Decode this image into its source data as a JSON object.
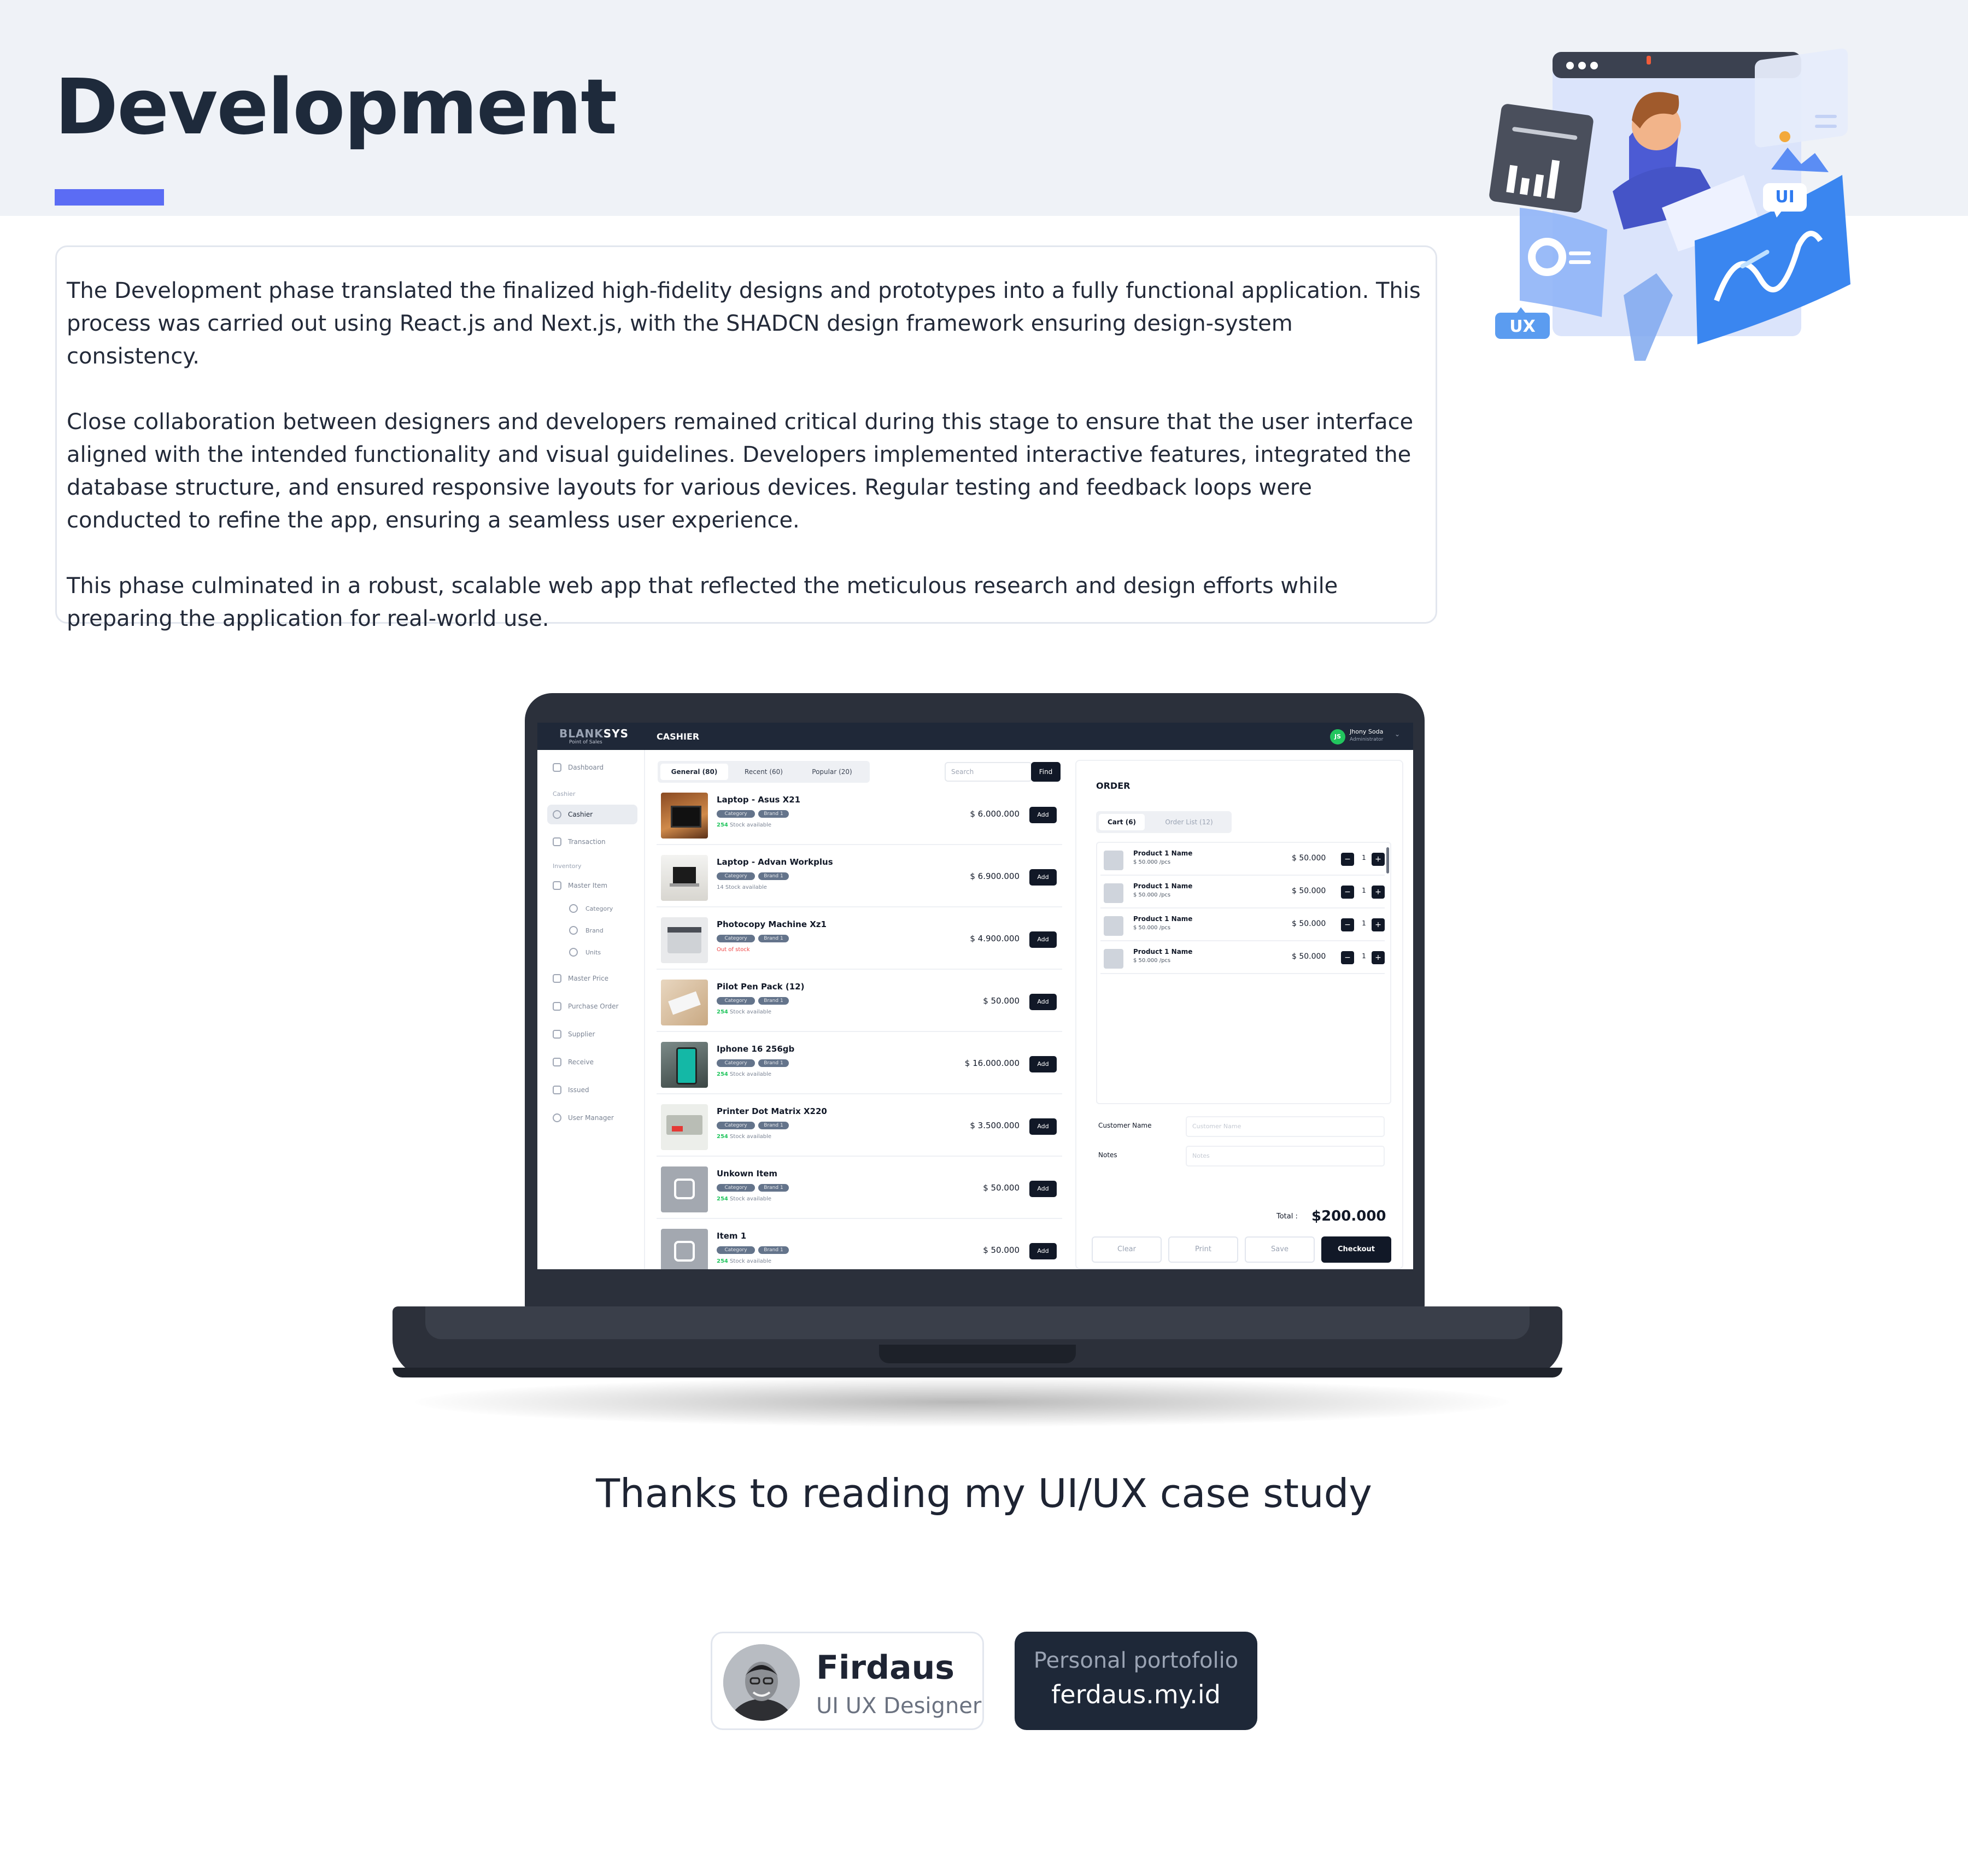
{
  "page": {
    "title": "Development",
    "paragraphs": [
      "The Development phase translated the finalized high-fidelity designs and prototypes into a fully functional application. This process was carried out using React.js and Next.js, with the SHADCN design framework ensuring design-system consistency.",
      "Close collaboration between designers and developers remained critical during this stage to ensure that the user interface aligned with the intended functionality and visual guidelines. Developers implemented interactive features, integrated the database structure, and ensured responsive layouts for various devices. Regular testing and feedback loops were conducted to refine the app, ensuring a seamless user experience.",
      "This phase culminated in a robust, scalable web app that reflected the meticulous research and design efforts while preparing the application for real-world use."
    ],
    "thanks": "Thanks to reading my UI/UX case study",
    "accent_color": "#5b6cf4"
  },
  "hero": {
    "ui_label": "UI",
    "ux_label": "UX"
  },
  "app": {
    "logo_blank": "BLANK",
    "logo_sys": "SYS",
    "logo_sub": "Point of Sales",
    "title": "CASHIER",
    "user": {
      "initials": "JS",
      "name": "Jhony Soda",
      "role": "Administrator"
    },
    "sidebar": {
      "dashboard": "Dashboard",
      "section_cashier": "Cashier",
      "cashier": "Cashier",
      "transaction": "Transaction",
      "section_inventory": "Inventory",
      "master_item": "Master Item",
      "category": "Category",
      "brand": "Brand",
      "units": "Units",
      "master_price": "Master Price",
      "purchase_order": "Purchase Order",
      "supplier": "Supplier",
      "receive": "Receive",
      "issued": "Issued",
      "user_manager": "User Manager"
    },
    "tabs": [
      "General (80)",
      "Recent (60)",
      "Popular (20)"
    ],
    "search_placeholder": "Search",
    "find_label": "Find",
    "pill_category": "Category",
    "pill_brand": "Brand 1",
    "add_label": "Add",
    "products": [
      {
        "name": "Laptop - Asus X21",
        "stock_count": "254",
        "stock_text": " Stock available",
        "price": "$ 6.000.000"
      },
      {
        "name": "Laptop - Advan Workplus",
        "stock_count": "",
        "stock_text": "14 Stock available",
        "price": "$ 6.900.000"
      },
      {
        "name": "Photocopy Machine Xz1",
        "stock_count": "",
        "stock_text": "Out of stock",
        "price": "$ 4.900.000"
      },
      {
        "name": "Pilot Pen Pack (12)",
        "stock_count": "254",
        "stock_text": " Stock available",
        "price": "$ 50.000"
      },
      {
        "name": "Iphone 16 256gb",
        "stock_count": "254",
        "stock_text": " Stock available",
        "price": "$ 16.000.000"
      },
      {
        "name": "Printer Dot Matrix X220",
        "stock_count": "254",
        "stock_text": " Stock available",
        "price": "$ 3.500.000"
      },
      {
        "name": "Unkown Item",
        "stock_count": "254",
        "stock_text": " Stock available",
        "price": "$ 50.000"
      },
      {
        "name": "Item 1",
        "stock_count": "254",
        "stock_text": " Stock available",
        "price": "$ 50.000"
      }
    ],
    "order": {
      "title": "ORDER",
      "tabs": [
        "Cart (6)",
        "Order List (12)"
      ],
      "items": [
        {
          "name": "Product 1 Name",
          "unit": "$ 50.000 /pcs",
          "price": "$ 50.000",
          "qty": "1"
        },
        {
          "name": "Product 1 Name",
          "unit": "$ 50.000 /pcs",
          "price": "$ 50.000",
          "qty": "1"
        },
        {
          "name": "Product 1 Name",
          "unit": "$ 50.000 /pcs",
          "price": "$ 50.000",
          "qty": "1"
        },
        {
          "name": "Product 1 Name",
          "unit": "$ 50.000 /pcs",
          "price": "$ 50.000",
          "qty": "1"
        }
      ],
      "customer_label": "Customer Name",
      "customer_placeholder": "Customer Name",
      "notes_label": "Notes",
      "notes_placeholder": "Notes",
      "total_label": "Total :",
      "total_value": "$200.000",
      "buttons": {
        "clear": "Clear",
        "print": "Print",
        "save": "Save",
        "checkout": "Checkout"
      }
    }
  },
  "author": {
    "name": "Firdaus",
    "role": "UI UX Designer"
  },
  "site": {
    "label": "Personal portofolio",
    "url": "ferdaus.my.id"
  }
}
